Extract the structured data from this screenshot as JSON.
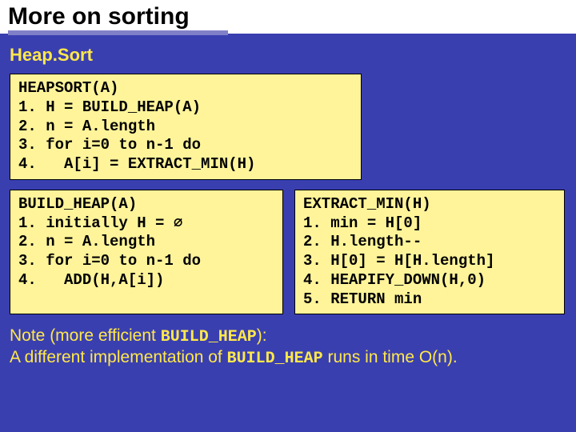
{
  "header": {
    "title": "More on sorting",
    "subtitle": "Heap.Sort"
  },
  "code": {
    "heapsort": "HEAPSORT(A)\n1. H = BUILD_HEAP(A)\n2. n = A.length\n3. for i=0 to n-1 do\n4.   A[i] = EXTRACT_MIN(H)",
    "build_heap": "BUILD_HEAP(A)\n1. initially H = ∅\n2. n = A.length\n3. for i=0 to n-1 do\n4.   ADD(H,A[i])",
    "extract_min": "EXTRACT_MIN(H)\n1. min = H[0]\n2. H.length--\n3. H[0] = H[H.length]\n4. HEAPIFY_DOWN(H,0)\n5. RETURN min"
  },
  "note": {
    "prefix1": "Note (more efficient ",
    "mono1": "BUILD_HEAP",
    "suffix1": "):",
    "prefix2": "A different implementation of ",
    "mono2": "BUILD_HEAP",
    "suffix2": " runs in time O(n)."
  }
}
